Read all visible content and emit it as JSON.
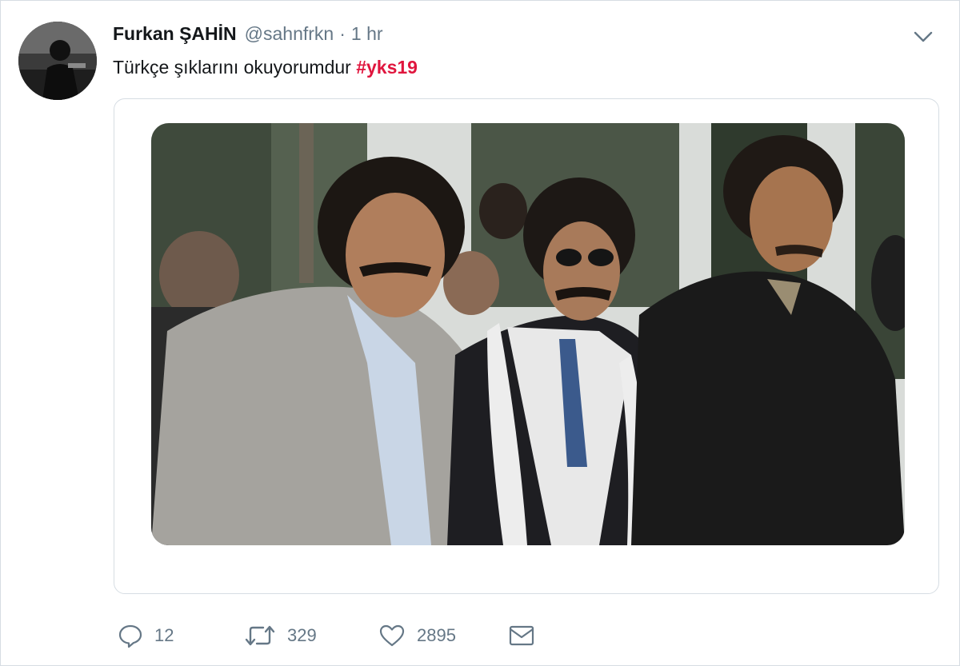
{
  "tweet": {
    "author": {
      "display_name": "Furkan ŞAHİN",
      "handle": "@sahnfrkn",
      "avatar_icon": "user-avatar"
    },
    "separator": "·",
    "timestamp": "1 hr",
    "text": "Türkçe şıklarını okuyorumdur",
    "hashtag": "#yks19",
    "menu_icon": "chevron-down-icon"
  },
  "media": {
    "kind": "photo",
    "icon": "photo-of-three-men"
  },
  "actions": {
    "reply": {
      "icon": "reply-icon",
      "count": "12"
    },
    "retweet": {
      "icon": "retweet-icon",
      "count": "329"
    },
    "like": {
      "icon": "heart-icon",
      "count": "2895"
    },
    "dm": {
      "icon": "envelope-icon"
    }
  },
  "colors": {
    "hashtag": "#e0163e",
    "text_primary": "#14171a",
    "text_secondary": "#657786",
    "border": "#d6dde3"
  }
}
